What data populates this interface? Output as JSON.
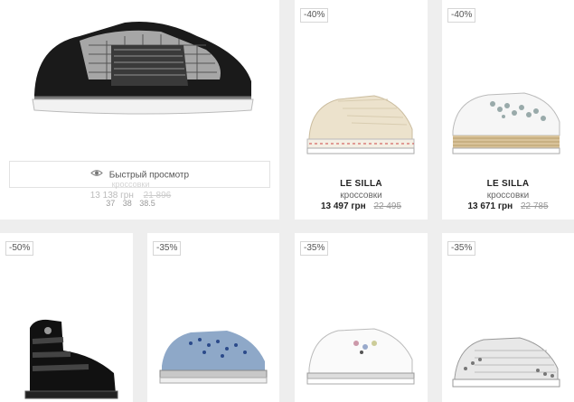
{
  "quick_view": {
    "label": "Быстрый просмотр",
    "ghost_type": "кроссовки"
  },
  "products": [
    {
      "id": "p1",
      "brand": "",
      "type": "кроссовки",
      "price": "13 138 грн",
      "old_price": "21 896",
      "sizes": [
        "37",
        "38",
        "38.5"
      ],
      "discount": ""
    },
    {
      "id": "p2",
      "brand": "LE SILLA",
      "type": "кроссовки",
      "price": "13 497 грн",
      "old_price": "22 495",
      "discount": "-40%"
    },
    {
      "id": "p3",
      "brand": "LE SILLA",
      "type": "кроссовки",
      "price": "13 671 грн",
      "old_price": "22 785",
      "discount": "-40%"
    },
    {
      "id": "p4",
      "discount": "-50%"
    },
    {
      "id": "p5",
      "discount": "-35%"
    },
    {
      "id": "p6",
      "discount": "-35%"
    },
    {
      "id": "p7",
      "discount": "-35%"
    }
  ],
  "colors": {
    "page_bg": "#eeeeee",
    "card_bg": "#ffffff",
    "old_price": "#999999"
  }
}
